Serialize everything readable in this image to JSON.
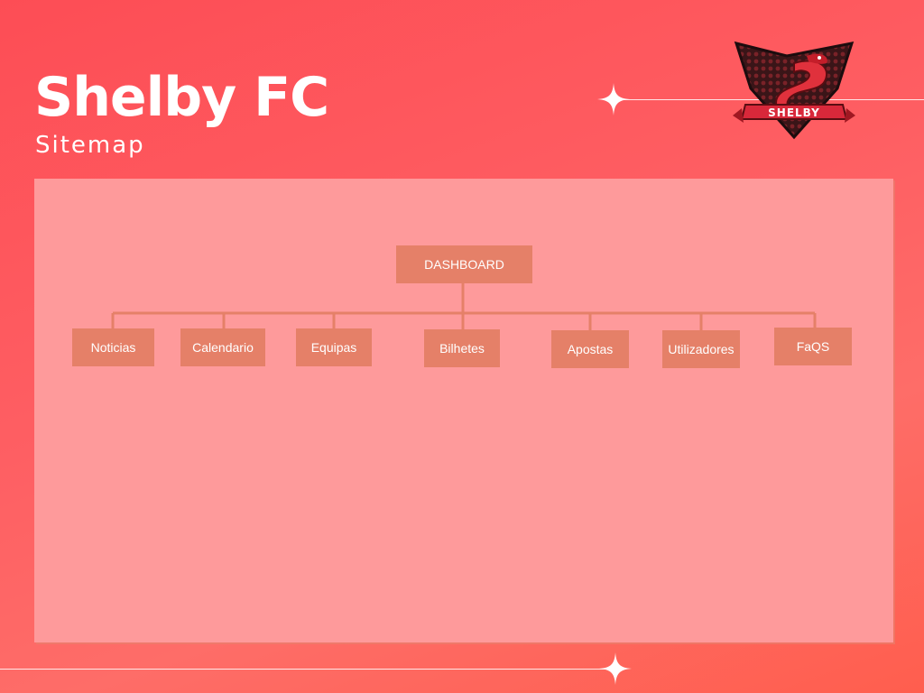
{
  "header": {
    "title": "Shelby FC",
    "subtitle": "Sitemap"
  },
  "logo": {
    "text": "SHELBY",
    "icon": "snake-shield-logo"
  },
  "sitemap": {
    "root": "DASHBOARD",
    "children": [
      "Noticias",
      "Calendario",
      "Equipas",
      "Bilhetes",
      "Apostas",
      "Utilizadores",
      "FaQS"
    ]
  },
  "colors": {
    "background": "#fe5a5e",
    "panel": "#fe9a9b",
    "node": "#e58068",
    "text": "#ffffff"
  }
}
